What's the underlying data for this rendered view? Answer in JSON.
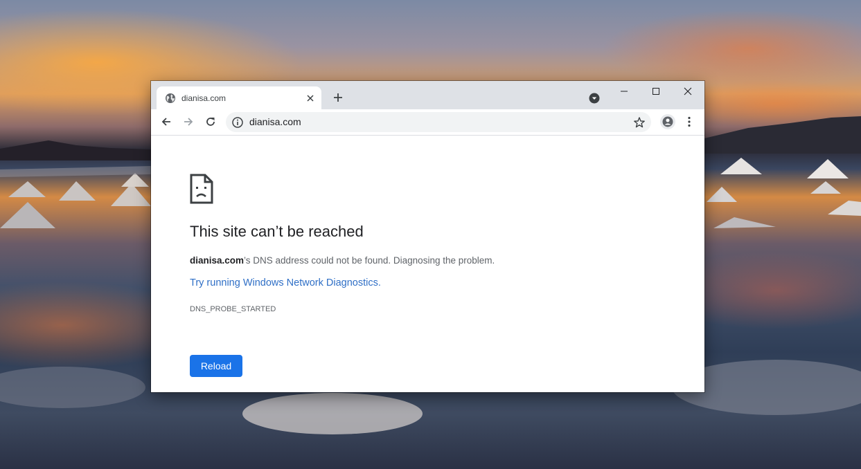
{
  "browser": {
    "tab": {
      "title": "dianisa.com",
      "favicon_icon": "globe-icon",
      "close_icon": "close-icon"
    },
    "new_tab_icon": "plus-icon",
    "tab_search_icon": "chevron-down-circle-icon",
    "window_controls": [
      "minimize-icon",
      "maximize-icon",
      "close-icon"
    ]
  },
  "toolbar": {
    "back_icon": "arrow-left-icon",
    "forward_icon": "arrow-right-icon",
    "reload_icon": "reload-icon",
    "address": "dianisa.com",
    "site_info_icon": "info-icon",
    "bookmark_icon": "star-icon",
    "account_icon": "person-icon",
    "menu_icon": "more-vertical-icon"
  },
  "error_page": {
    "icon": "sad-page-icon",
    "title": "This site can’t be reached",
    "description_domain": "dianisa.com",
    "description_rest": "’s DNS address could not be found. Diagnosing the problem.",
    "link": "Try running Windows Network Diagnostics.",
    "error_code": "DNS_PROBE_STARTED",
    "reload_label": "Reload"
  },
  "colors": {
    "accent": "#1a73e8",
    "link": "#2f6fc6",
    "tabstrip": "#dee1e6"
  }
}
